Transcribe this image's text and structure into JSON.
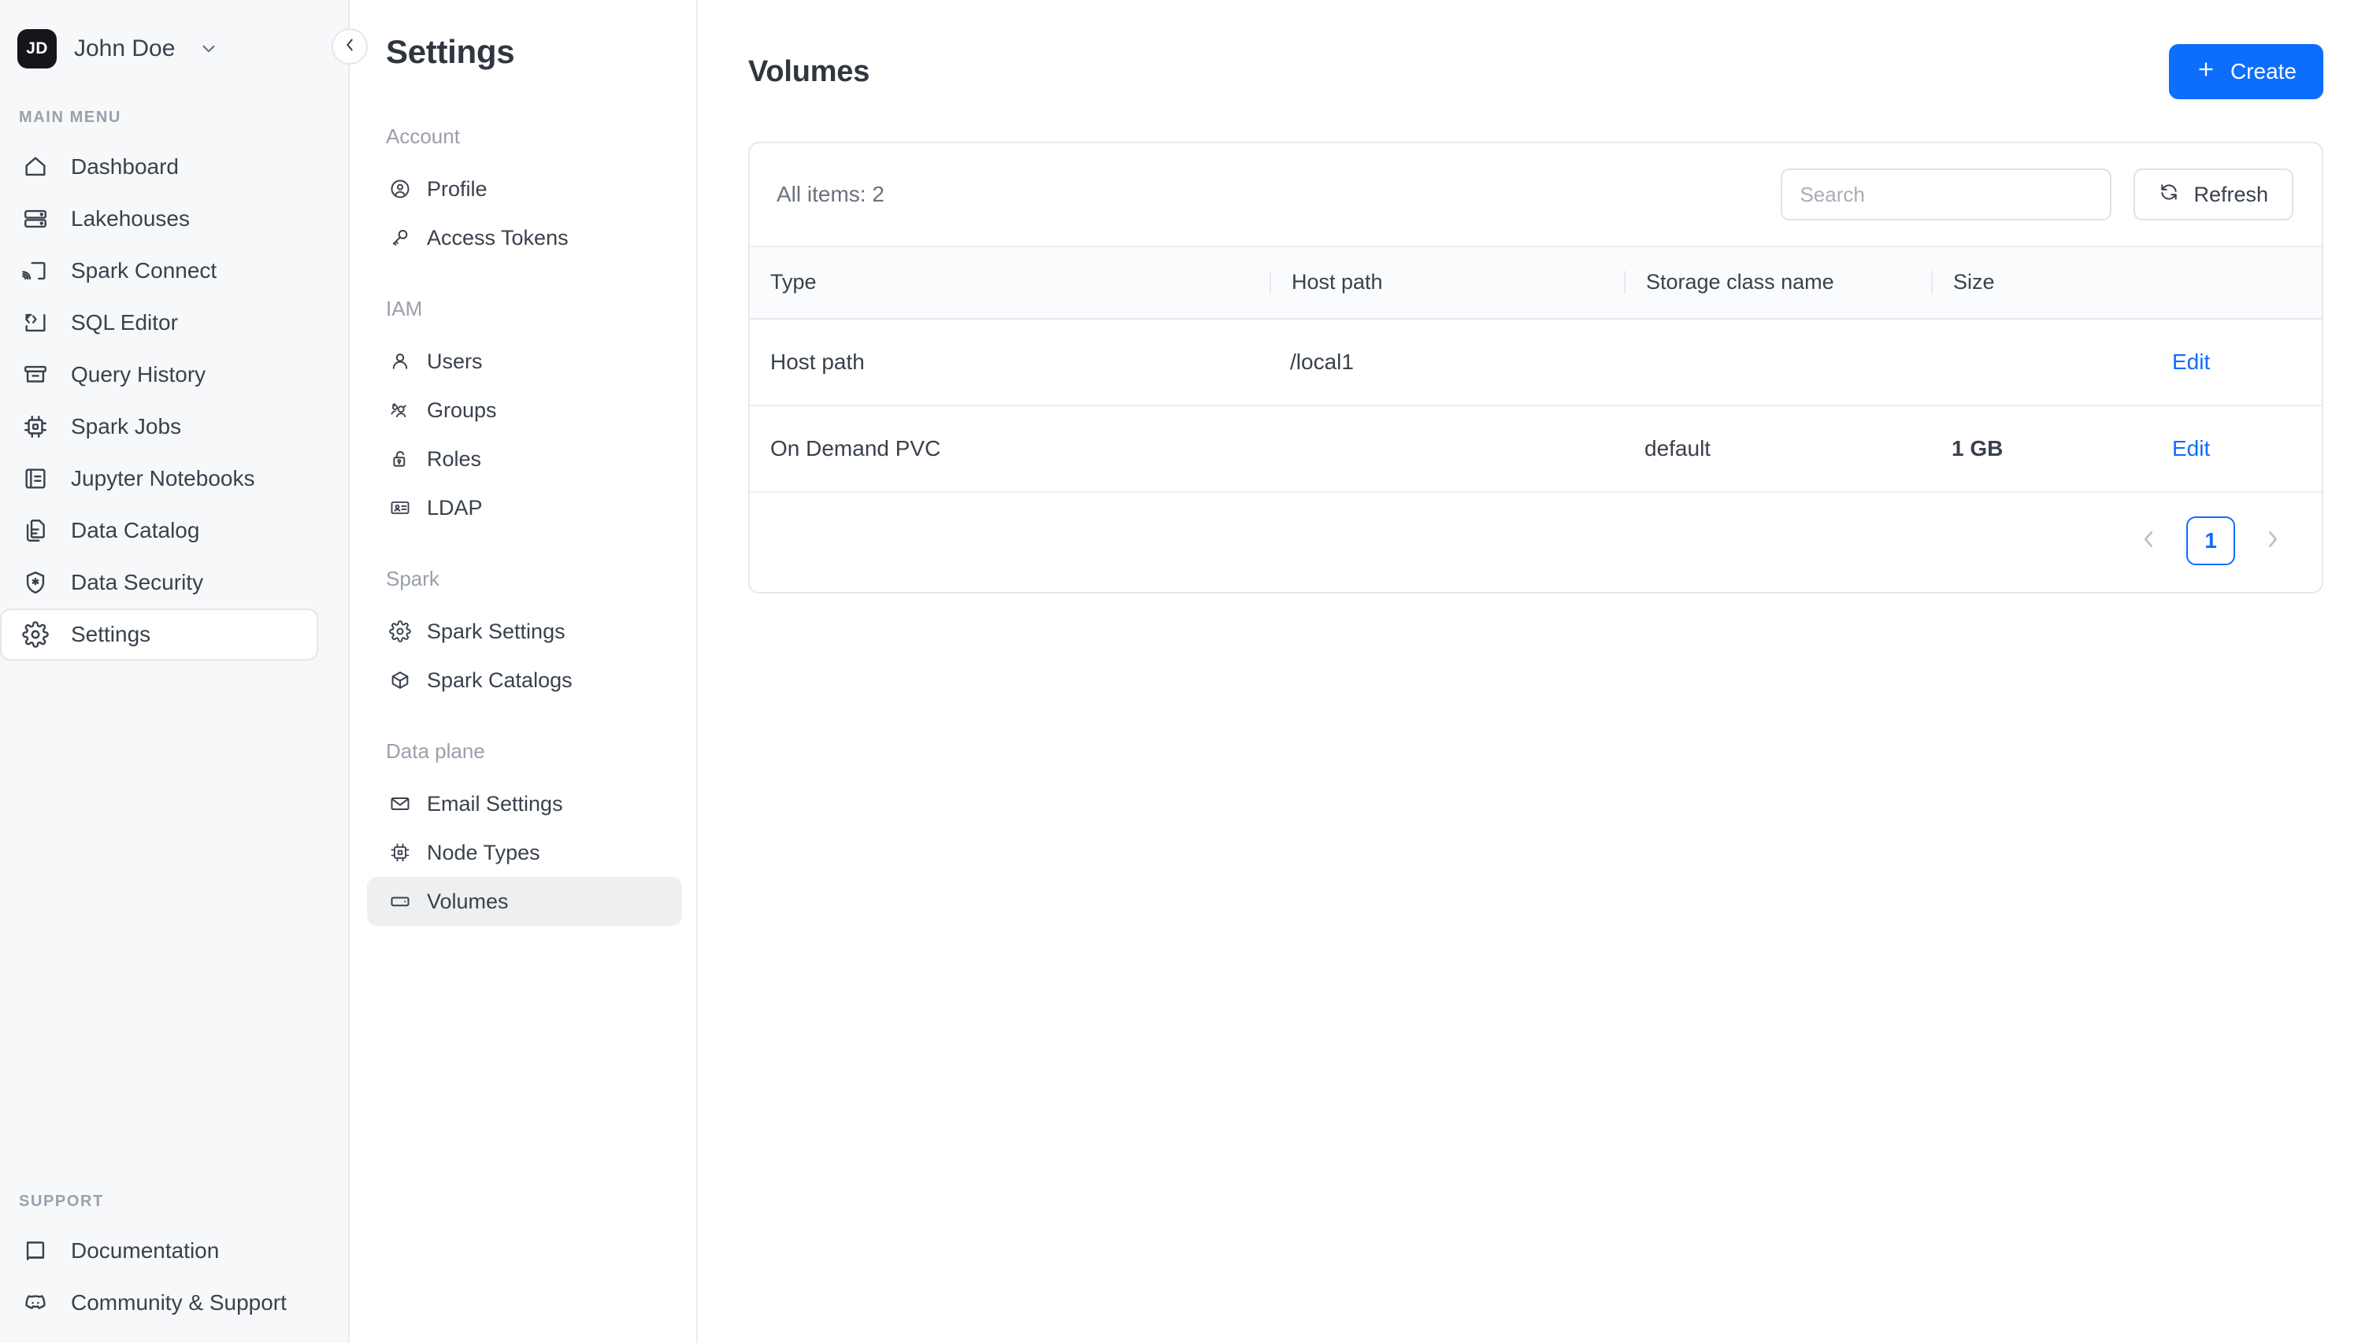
{
  "sidebar": {
    "user": {
      "initials": "JD",
      "name": "John Doe",
      "chevron_icon": "chevron-down-icon"
    },
    "collapse_icon": "chevron-left-icon",
    "main_menu_label": "MAIN MENU",
    "items": [
      {
        "label": "Dashboard",
        "icon": "home-icon"
      },
      {
        "label": "Lakehouses",
        "icon": "database-icon"
      },
      {
        "label": "Spark Connect",
        "icon": "cast-icon"
      },
      {
        "label": "SQL Editor",
        "icon": "code-icon"
      },
      {
        "label": "Query History",
        "icon": "archive-icon"
      },
      {
        "label": "Spark Jobs",
        "icon": "cpu-icon"
      },
      {
        "label": "Jupyter Notebooks",
        "icon": "notebook-icon"
      },
      {
        "label": "Data Catalog",
        "icon": "files-icon"
      },
      {
        "label": "Data Security",
        "icon": "shield-star-icon"
      },
      {
        "label": "Settings",
        "icon": "gear-icon",
        "active": true
      }
    ],
    "support_label": "SUPPORT",
    "support_items": [
      {
        "label": "Documentation",
        "icon": "book-icon"
      },
      {
        "label": "Community & Support",
        "icon": "discord-icon"
      }
    ]
  },
  "settings": {
    "title": "Settings",
    "groups": [
      {
        "label": "Account",
        "items": [
          {
            "label": "Profile",
            "icon": "user-circle-icon"
          },
          {
            "label": "Access Tokens",
            "icon": "key-icon"
          }
        ]
      },
      {
        "label": "IAM",
        "items": [
          {
            "label": "Users",
            "icon": "user-icon"
          },
          {
            "label": "Groups",
            "icon": "users-icon"
          },
          {
            "label": "Roles",
            "icon": "lock-open-icon"
          },
          {
            "label": "LDAP",
            "icon": "id-card-icon"
          }
        ]
      },
      {
        "label": "Spark",
        "items": [
          {
            "label": "Spark Settings",
            "icon": "gear-icon"
          },
          {
            "label": "Spark Catalogs",
            "icon": "cube-icon"
          }
        ]
      },
      {
        "label": "Data plane",
        "items": [
          {
            "label": "Email Settings",
            "icon": "mail-icon"
          },
          {
            "label": "Node Types",
            "icon": "cpu-icon"
          },
          {
            "label": "Volumes",
            "icon": "volume-icon",
            "active": true
          }
        ]
      }
    ]
  },
  "main": {
    "title": "Volumes",
    "create_label": "Create",
    "create_icon": "plus-icon",
    "toolbar": {
      "items_count_label": "All items: 2",
      "search_placeholder": "Search",
      "search_value": "",
      "refresh_label": "Refresh",
      "refresh_icon": "refresh-icon"
    },
    "table": {
      "columns": [
        "Type",
        "Host path",
        "Storage class name",
        "Size",
        ""
      ],
      "rows": [
        {
          "type": "Host path",
          "host_path": "/local1",
          "storage_class_name": "",
          "size": "",
          "action_label": "Edit"
        },
        {
          "type": "On Demand PVC",
          "host_path": "",
          "storage_class_name": "default",
          "size": "1 GB",
          "action_label": "Edit"
        }
      ]
    },
    "pagination": {
      "prev_icon": "chevron-left-icon",
      "next_icon": "chevron-right-icon",
      "current_page": "1"
    }
  },
  "colors": {
    "accent": "#0d6efd",
    "sidebar_bg": "#f7f8fa",
    "text": "#39414d",
    "muted": "#9aa0ab"
  }
}
